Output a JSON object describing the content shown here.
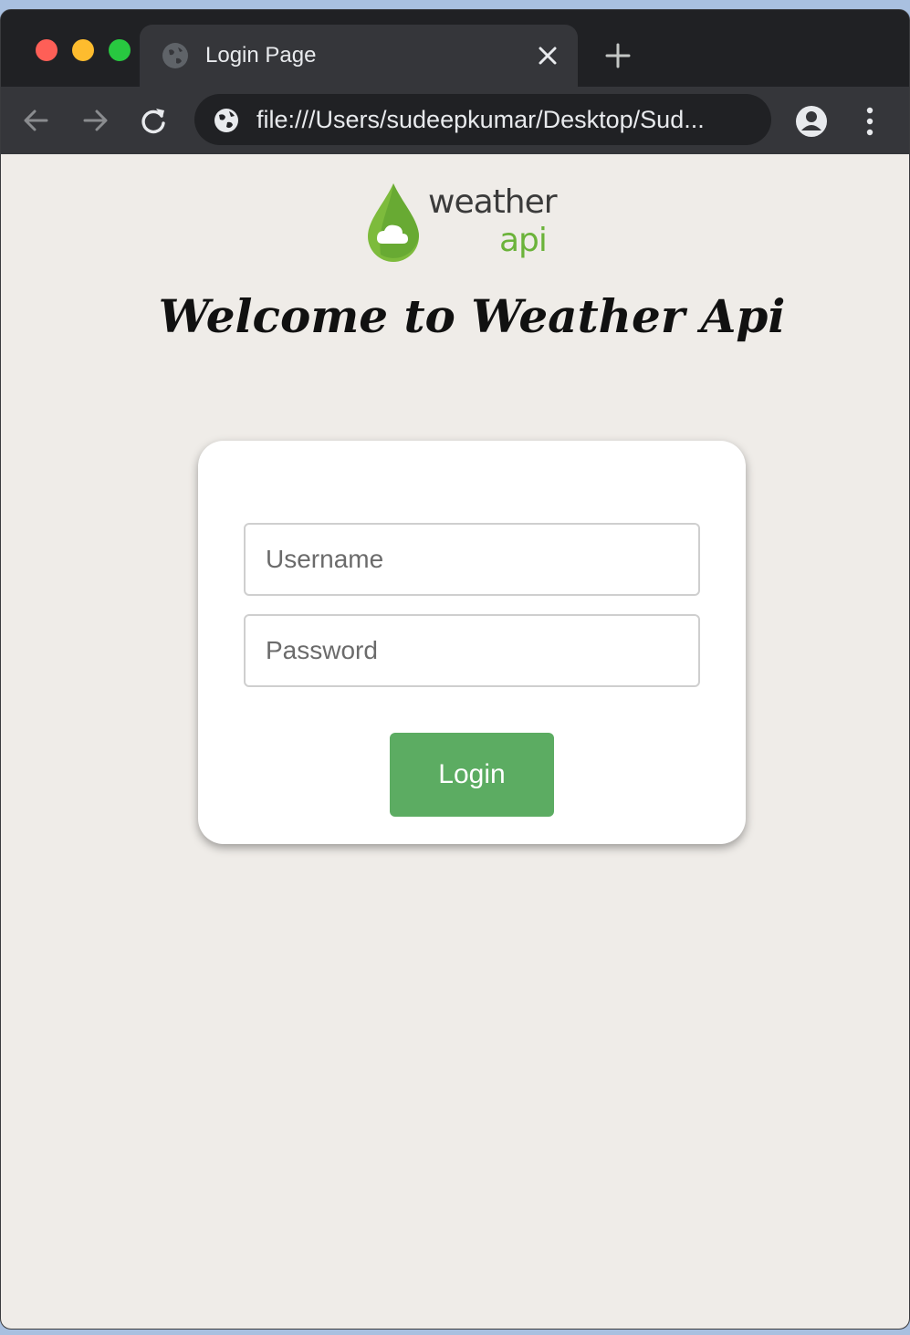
{
  "browser": {
    "tab_title": "Login Page",
    "address": "file:///Users/sudeepkumar/Desktop/Sud...",
    "icons": {
      "favicon": "globe-icon",
      "close": "close-icon",
      "new_tab": "plus-icon",
      "back": "arrow-left-icon",
      "forward": "arrow-right-icon",
      "reload": "reload-icon",
      "site_info": "globe-icon",
      "profile": "profile-icon",
      "menu": "kebab-menu-icon"
    }
  },
  "page": {
    "logo": {
      "word_top": "weather",
      "word_bottom": "api"
    },
    "heading": "Welcome to Weather Api",
    "form": {
      "username_placeholder": "Username",
      "password_placeholder": "Password",
      "login_label": "Login"
    }
  },
  "colors": {
    "page_bg": "#efece8",
    "button_bg": "#5cac62",
    "logo_green": "#6bb33a"
  }
}
